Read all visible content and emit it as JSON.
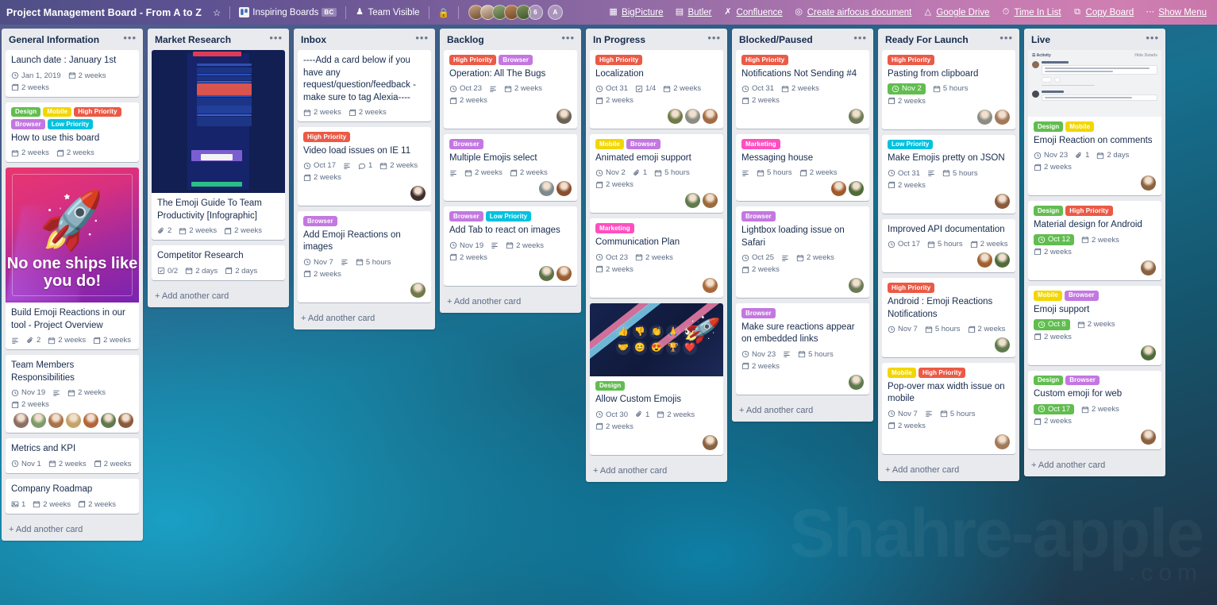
{
  "topbar": {
    "board_title": "Project Management Board - From A to Z",
    "star_icon": "star-icon",
    "workspace": {
      "icon": "trello-logo-icon",
      "label": "Inspiring Boards",
      "badge": "BC"
    },
    "visibility": {
      "icon": "people-icon",
      "label": "Team Visible"
    },
    "lock_icon": "lock-icon",
    "members_overflow": "6",
    "invite_badge": "A",
    "power_ups": [
      {
        "icon": "bigpicture-icon",
        "label": "BigPicture",
        "underline": false
      },
      {
        "icon": "butler-icon",
        "label": "Butler",
        "underline": false
      },
      {
        "icon": "confluence-icon",
        "label": "Confluence",
        "underline": true
      },
      {
        "icon": "airfocus-icon",
        "label": "Create airfocus document",
        "underline": true
      },
      {
        "icon": "google-drive-icon",
        "label": "Google Drive",
        "underline": true
      },
      {
        "icon": "time-in-list-icon",
        "label": "Time In List",
        "underline": true
      },
      {
        "icon": "copy-board-icon",
        "label": "Copy Board",
        "underline": true
      },
      {
        "icon": "ellipsis-icon",
        "label": "Show Menu",
        "underline": true
      }
    ]
  },
  "watermark": {
    "line1": "Shahre-apple",
    "line2": ".com"
  },
  "add_card_label": "+ Add another card",
  "label_colors": {
    "Design": "#61bd4f",
    "Mobile": "#f2d600",
    "High Priority": "#eb5a46",
    "Browser": "#c377e0",
    "Low Priority": "#00c2e0",
    "Marketing": "#ff4fbf"
  },
  "lists": [
    {
      "title": "General Information",
      "cards": [
        {
          "title": "Launch date : January 1st",
          "labels": [],
          "badges": [
            {
              "icon": "clock-icon",
              "text": "Jan 1, 2019"
            },
            {
              "icon": "calendar-icon",
              "text": "2 weeks"
            },
            {
              "icon": "card-icon",
              "text": "2 weeks"
            }
          ],
          "avatars": []
        },
        {
          "title": "How to use this board",
          "labels": [
            "Design",
            "Mobile",
            "High Priority",
            "Browser",
            "Low Priority"
          ],
          "badges": [
            {
              "icon": "calendar-icon",
              "text": "2 weeks"
            },
            {
              "icon": "card-icon",
              "text": "2 weeks"
            }
          ],
          "avatars": []
        },
        {
          "title": "Build Emoji Reactions in our tool - Project Overview",
          "cover": "rocket",
          "cover_caption": "No one ships like you do!",
          "labels": [],
          "badges": [
            {
              "icon": "description-icon",
              "text": ""
            },
            {
              "icon": "attachment-icon",
              "text": "2"
            },
            {
              "icon": "calendar-icon",
              "text": "2 weeks"
            },
            {
              "icon": "card-icon",
              "text": "2 weeks"
            }
          ],
          "avatars": []
        },
        {
          "title": "Team Members Responsibilities",
          "labels": [],
          "badges": [
            {
              "icon": "clock-icon",
              "text": "Nov 19"
            },
            {
              "icon": "description-icon",
              "text": ""
            },
            {
              "icon": "calendar-icon",
              "text": "2 weeks"
            },
            {
              "icon": "card-icon",
              "text": "2 weeks"
            }
          ],
          "avatars": [
            "#8d6e63",
            "#7e9b6a",
            "#a9714b",
            "#c4a36a",
            "#b4643a",
            "#5f7a4e",
            "#8a5a3b"
          ]
        },
        {
          "title": "Metrics and KPI",
          "labels": [],
          "badges": [
            {
              "icon": "clock-icon",
              "text": "Nov 1"
            },
            {
              "icon": "calendar-icon",
              "text": "2 weeks"
            },
            {
              "icon": "card-icon",
              "text": "2 weeks"
            }
          ],
          "avatars": []
        },
        {
          "title": "Company Roadmap",
          "labels": [],
          "badges": [
            {
              "icon": "image-icon",
              "text": "1"
            },
            {
              "icon": "calendar-icon",
              "text": "2 weeks"
            },
            {
              "icon": "card-icon",
              "text": "2 weeks"
            }
          ],
          "avatars": []
        }
      ]
    },
    {
      "title": "Market Research",
      "cards": [
        {
          "title": "The Emoji Guide To Team Productivity [Infographic]",
          "cover": "infographic",
          "labels": [],
          "badges": [
            {
              "icon": "attachment-icon",
              "text": "2"
            },
            {
              "icon": "calendar-icon",
              "text": "2 weeks"
            },
            {
              "icon": "card-icon",
              "text": "2 weeks"
            }
          ],
          "avatars": []
        },
        {
          "title": "Competitor Research",
          "labels": [],
          "badges": [
            {
              "icon": "checklist-icon",
              "text": "0/2"
            },
            {
              "icon": "calendar-icon",
              "text": "2 days"
            },
            {
              "icon": "card-icon",
              "text": "2 days"
            }
          ],
          "avatars": []
        }
      ]
    },
    {
      "title": "Inbox",
      "cards": [
        {
          "title": "----Add a card below if you have any request/question/feedback - make sure to tag Alexia----",
          "labels": [],
          "badges": [
            {
              "icon": "calendar-icon",
              "text": "2 weeks"
            },
            {
              "icon": "card-icon",
              "text": "2 weeks"
            }
          ],
          "avatars": []
        },
        {
          "title": "Video load issues on IE 11",
          "labels": [
            "High Priority"
          ],
          "badges": [
            {
              "icon": "clock-icon",
              "text": "Oct 17"
            },
            {
              "icon": "description-icon",
              "text": ""
            },
            {
              "icon": "comment-icon",
              "text": "1"
            },
            {
              "icon": "calendar-icon",
              "text": "2 weeks"
            },
            {
              "icon": "card-icon",
              "text": "2 weeks"
            }
          ],
          "avatars": [
            "#3f2f2a"
          ]
        },
        {
          "title": "Add Emoji Reactions on images",
          "labels": [
            "Browser"
          ],
          "badges": [
            {
              "icon": "clock-icon",
              "text": "Nov 7"
            },
            {
              "icon": "description-icon",
              "text": ""
            },
            {
              "icon": "calendar-icon",
              "text": "5 hours"
            },
            {
              "icon": "card-icon",
              "text": "2 weeks"
            }
          ],
          "avatars": [
            "#6f7a4a"
          ]
        }
      ]
    },
    {
      "title": "Backlog",
      "cards": [
        {
          "title": "Operation: All The Bugs",
          "labels": [
            "High Priority",
            "Browser"
          ],
          "badges": [
            {
              "icon": "clock-icon",
              "text": "Oct 23"
            },
            {
              "icon": "description-icon",
              "text": ""
            },
            {
              "icon": "calendar-icon",
              "text": "2 weeks"
            },
            {
              "icon": "card-icon",
              "text": "2 weeks"
            }
          ],
          "avatars": [
            "#6b6355"
          ]
        },
        {
          "title": "Multiple Emojis select",
          "labels": [
            "Browser"
          ],
          "badges": [
            {
              "icon": "description-icon",
              "text": ""
            },
            {
              "icon": "calendar-icon",
              "text": "2 weeks"
            },
            {
              "icon": "card-icon",
              "text": "2 weeks"
            }
          ],
          "avatars": [
            "#7d8a8f",
            "#8a4f2f"
          ]
        },
        {
          "title": "Add Tab to react on images",
          "labels": [
            "Browser",
            "Low Priority"
          ],
          "badges": [
            {
              "icon": "clock-icon",
              "text": "Nov 19"
            },
            {
              "icon": "description-icon",
              "text": ""
            },
            {
              "icon": "calendar-icon",
              "text": "2 weeks"
            },
            {
              "icon": "card-icon",
              "text": "2 weeks"
            }
          ],
          "avatars": [
            "#5e7046",
            "#9a5f33"
          ]
        }
      ]
    },
    {
      "title": "In Progress",
      "cards": [
        {
          "title": "Localization",
          "labels": [
            "High Priority"
          ],
          "badges": [
            {
              "icon": "clock-icon",
              "text": "Oct 31"
            },
            {
              "icon": "checklist-icon",
              "text": "1/4"
            },
            {
              "icon": "calendar-icon",
              "text": "2 weeks"
            },
            {
              "icon": "card-icon",
              "text": "2 weeks"
            }
          ],
          "avatars": [
            "#6f7b48",
            "#8b8d85",
            "#a36a44"
          ]
        },
        {
          "title": "Animated emoji support",
          "labels": [
            "Mobile",
            "Browser"
          ],
          "badges": [
            {
              "icon": "clock-icon",
              "text": "Nov 2"
            },
            {
              "icon": "attachment-icon",
              "text": "1"
            },
            {
              "icon": "calendar-icon",
              "text": "5 hours"
            },
            {
              "icon": "card-icon",
              "text": "2 weeks"
            }
          ],
          "avatars": [
            "#5f7a4e",
            "#9a6b3c"
          ]
        },
        {
          "title": "Communication Plan",
          "labels": [
            "Marketing"
          ],
          "badges": [
            {
              "icon": "clock-icon",
              "text": "Oct 23"
            },
            {
              "icon": "calendar-icon",
              "text": "2 weeks"
            },
            {
              "icon": "card-icon",
              "text": "2 weeks"
            }
          ],
          "avatars": [
            "#a8683a"
          ]
        },
        {
          "title": "Allow Custom Emojis",
          "cover": "emoji",
          "labels": [
            "Design"
          ],
          "badges": [
            {
              "icon": "clock-icon",
              "text": "Oct 30"
            },
            {
              "icon": "attachment-icon",
              "text": "1"
            },
            {
              "icon": "calendar-icon",
              "text": "2 weeks"
            },
            {
              "icon": "card-icon",
              "text": "2 weeks"
            }
          ],
          "avatars": [
            "#8a6240"
          ]
        }
      ]
    },
    {
      "title": "Blocked/Paused",
      "cards": [
        {
          "title": "Notifications Not Sending #4",
          "labels": [
            "High Priority"
          ],
          "badges": [
            {
              "icon": "clock-icon",
              "text": "Oct 31"
            },
            {
              "icon": "calendar-icon",
              "text": "2 weeks"
            },
            {
              "icon": "card-icon",
              "text": "2 weeks"
            }
          ],
          "avatars": [
            "#6c7a56"
          ]
        },
        {
          "title": "Messaging house",
          "labels": [
            "Marketing"
          ],
          "badges": [
            {
              "icon": "description-icon",
              "text": ""
            },
            {
              "icon": "calendar-icon",
              "text": "5 hours"
            },
            {
              "icon": "card-icon",
              "text": "2 weeks"
            }
          ],
          "avatars": [
            "#a05b2c",
            "#4f6b3a"
          ]
        },
        {
          "title": "Lightbox loading issue on Safari",
          "labels": [
            "Browser"
          ],
          "badges": [
            {
              "icon": "clock-icon",
              "text": "Oct 25"
            },
            {
              "icon": "description-icon",
              "text": ""
            },
            {
              "icon": "calendar-icon",
              "text": "2 weeks"
            },
            {
              "icon": "card-icon",
              "text": "2 weeks"
            }
          ],
          "avatars": [
            "#6c7a56"
          ]
        },
        {
          "title": "Make sure reactions appear on embedded links",
          "labels": [
            "Browser"
          ],
          "badges": [
            {
              "icon": "clock-icon",
              "text": "Nov 23"
            },
            {
              "icon": "description-icon",
              "text": ""
            },
            {
              "icon": "calendar-icon",
              "text": "5 hours"
            },
            {
              "icon": "card-icon",
              "text": "2 weeks"
            }
          ],
          "avatars": [
            "#5f7a4e"
          ]
        }
      ]
    },
    {
      "title": "Ready For Launch",
      "cards": [
        {
          "title": "Pasting from clipboard",
          "labels": [
            "High Priority"
          ],
          "badges": [
            {
              "icon": "clock-icon",
              "text": "Nov 2",
              "due": true
            },
            {
              "icon": "calendar-icon",
              "text": "5 hours"
            },
            {
              "icon": "card-icon",
              "text": "2 weeks"
            }
          ],
          "avatars": [
            "#8b8d85",
            "#a2795a"
          ]
        },
        {
          "title": "Make Emojis pretty on JSON",
          "labels": [
            "Low Priority"
          ],
          "badges": [
            {
              "icon": "clock-icon",
              "text": "Oct 31"
            },
            {
              "icon": "description-icon",
              "text": ""
            },
            {
              "icon": "calendar-icon",
              "text": "5 hours"
            },
            {
              "icon": "card-icon",
              "text": "2 weeks"
            }
          ],
          "avatars": [
            "#8a5a3b"
          ]
        },
        {
          "title": "Improved API documentation",
          "labels": [],
          "badges": [
            {
              "icon": "clock-icon",
              "text": "Oct 17"
            },
            {
              "icon": "calendar-icon",
              "text": "5 hours"
            },
            {
              "icon": "card-icon",
              "text": "2 weeks"
            }
          ],
          "avatars": [
            "#a0602f",
            "#4f6b3a"
          ]
        },
        {
          "title": "Android : Emoji Reactions Notifications",
          "labels": [
            "High Priority"
          ],
          "badges": [
            {
              "icon": "clock-icon",
              "text": "Nov 7"
            },
            {
              "icon": "calendar-icon",
              "text": "5 hours"
            },
            {
              "icon": "card-icon",
              "text": "2 weeks"
            }
          ],
          "avatars": [
            "#5f7a4e"
          ]
        },
        {
          "title": "Pop-over max width issue on mobile",
          "labels": [
            "Mobile",
            "High Priority"
          ],
          "badges": [
            {
              "icon": "clock-icon",
              "text": "Nov 7"
            },
            {
              "icon": "description-icon",
              "text": ""
            },
            {
              "icon": "calendar-icon",
              "text": "5 hours"
            },
            {
              "icon": "card-icon",
              "text": "2 weeks"
            }
          ],
          "avatars": [
            "#a2795a"
          ]
        }
      ]
    },
    {
      "title": "Live",
      "cards": [
        {
          "title": "Emoji Reaction on comments",
          "cover": "activity",
          "labels": [
            "Design",
            "Mobile"
          ],
          "badges": [
            {
              "icon": "clock-icon",
              "text": "Nov 23"
            },
            {
              "icon": "attachment-icon",
              "text": "1"
            },
            {
              "icon": "calendar-icon",
              "text": "2 days"
            },
            {
              "icon": "card-icon",
              "text": "2 weeks"
            }
          ],
          "avatars": [
            "#8a6240"
          ]
        },
        {
          "title": "Material design for Android",
          "labels": [
            "Design",
            "High Priority"
          ],
          "badges": [
            {
              "icon": "clock-icon",
              "text": "Oct 12",
              "due": true
            },
            {
              "icon": "calendar-icon",
              "text": "2 weeks"
            },
            {
              "icon": "card-icon",
              "text": "2 weeks"
            }
          ],
          "avatars": [
            "#8a6240"
          ]
        },
        {
          "title": "Emoji support",
          "labels": [
            "Mobile",
            "Browser"
          ],
          "badges": [
            {
              "icon": "clock-icon",
              "text": "Oct 8",
              "due": true
            },
            {
              "icon": "calendar-icon",
              "text": "2 weeks"
            },
            {
              "icon": "card-icon",
              "text": "2 weeks"
            }
          ],
          "avatars": [
            "#4f6b3a"
          ]
        },
        {
          "title": "Custom emoji for web",
          "labels": [
            "Design",
            "Browser"
          ],
          "badges": [
            {
              "icon": "clock-icon",
              "text": "Oct 17",
              "due": true
            },
            {
              "icon": "calendar-icon",
              "text": "2 weeks"
            },
            {
              "icon": "card-icon",
              "text": "2 weeks"
            }
          ],
          "avatars": [
            "#8a6240"
          ]
        }
      ]
    }
  ]
}
